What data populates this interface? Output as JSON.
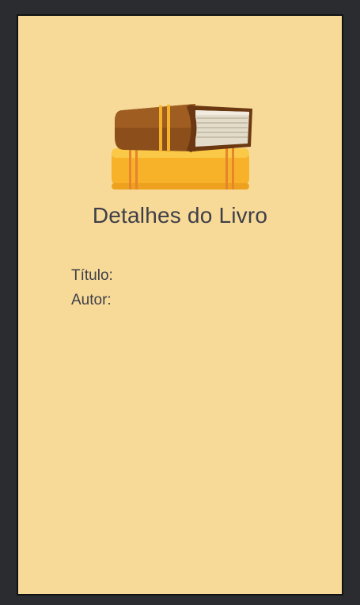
{
  "app": {
    "page_title": "Detalhes do Livro",
    "logo_icon": "books-stack-icon"
  },
  "details": {
    "title_label": "Título:",
    "title_value": "",
    "author_label": "Autor:",
    "author_value": ""
  },
  "colors": {
    "background": "#f7da98",
    "text": "#3f3f49",
    "frame": "#2b2c2f"
  }
}
